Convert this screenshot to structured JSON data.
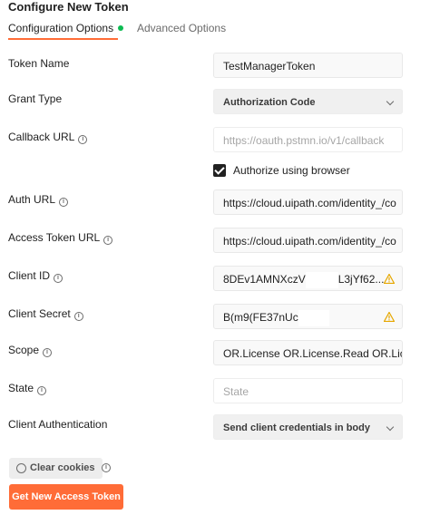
{
  "header": {
    "title": "Configure New Token"
  },
  "tabs": [
    {
      "label": "Configuration Options"
    },
    {
      "label": "Advanced Options"
    }
  ],
  "colors": {
    "accent": "#ff6c37",
    "active_dot": "#0cbb52",
    "warning": "#e6a700"
  },
  "form": {
    "token_name": {
      "label": "Token Name",
      "value": "TestManagerToken"
    },
    "grant_type": {
      "label": "Grant Type",
      "value": "Authorization Code"
    },
    "callback_url": {
      "label": "Callback URL",
      "placeholder": "https://oauth.pstmn.io/v1/callback"
    },
    "authorize_browser": {
      "label": "Authorize using browser",
      "checked": true
    },
    "auth_url": {
      "label": "Auth URL",
      "value": "https://cloud.uipath.com/identity_/co"
    },
    "access_token_url": {
      "label": "Access Token URL",
      "value": "https://cloud.uipath.com/identity_/co"
    },
    "client_id": {
      "label": "Client ID",
      "value_start": "8DEv1AMNXczV",
      "value_end": "L3jYf62..."
    },
    "client_secret": {
      "label": "Client Secret",
      "value_start": "B(m9(FE37nUc"
    },
    "scope": {
      "label": "Scope",
      "value": "OR.License OR.License.Read OR.Lice"
    },
    "state": {
      "label": "State",
      "placeholder": "State"
    },
    "client_authentication": {
      "label": "Client Authentication",
      "value": "Send client credentials in body"
    }
  },
  "actions": {
    "clear_cookies": "Clear cookies",
    "get_token": "Get New Access Token"
  }
}
